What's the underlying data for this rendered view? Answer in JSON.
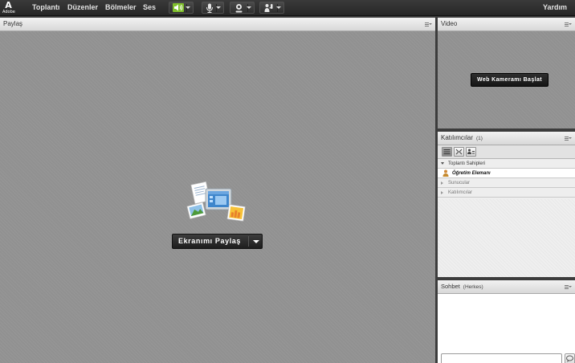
{
  "app": {
    "logo_mark": "A",
    "logo_word": "Adobe"
  },
  "menubar": {
    "items": [
      "Toplantı",
      "Düzenler",
      "Bölmeler",
      "Ses"
    ],
    "help_label": "Yardım",
    "controls": [
      {
        "name": "speaker",
        "icon": "speaker-icon",
        "state": "on"
      },
      {
        "name": "microphone",
        "icon": "microphone-icon"
      },
      {
        "name": "camera",
        "icon": "webcam-icon"
      },
      {
        "name": "status",
        "icon": "raise-hand-icon"
      }
    ]
  },
  "share_pod": {
    "title": "Paylaş",
    "share_button_label": "Ekranımı Paylaş",
    "icon": "share-documents-icon"
  },
  "video_pod": {
    "title": "Video",
    "start_button_label": "Web Kameramı Başlat"
  },
  "attendees_pod": {
    "title": "Katılımcılar",
    "count": "(1)",
    "view_buttons": [
      "list-view-icon",
      "grid-view-icon",
      "role-view-icon"
    ],
    "groups": [
      {
        "label": "Toplantı Sahipleri",
        "expanded": true
      },
      {
        "label": "Sunucular",
        "expanded": false
      },
      {
        "label": "Katılımcılar",
        "expanded": false
      }
    ],
    "hosts": [
      {
        "name": "Öğretim Elemanı",
        "icon": "host-user-icon"
      }
    ]
  },
  "chat_pod": {
    "title": "Sohbet",
    "scope": "(Herkes)",
    "input_value": ""
  },
  "colors": {
    "speaker_on": "#8ed13a",
    "menubar_bg": "#2b2b2b",
    "stage_bg": "#8e8e8e",
    "pod_header": "#e6e6e6"
  }
}
